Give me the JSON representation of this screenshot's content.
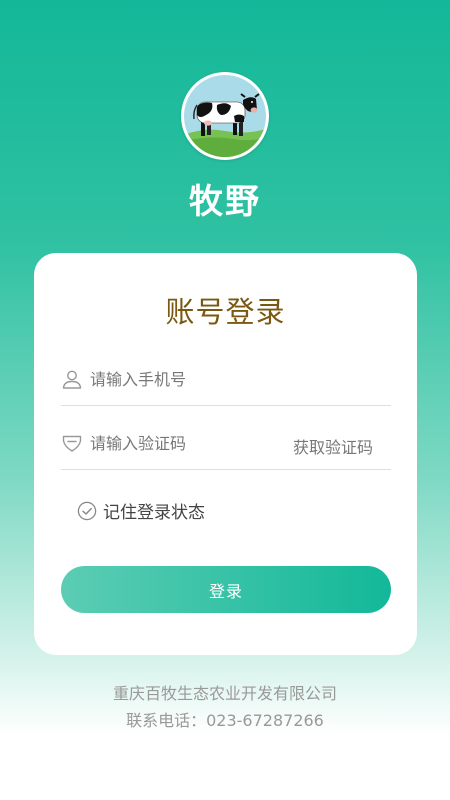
{
  "app": {
    "name": "牧野"
  },
  "login": {
    "title": "账号登录",
    "phone_placeholder": "请输入手机号",
    "code_placeholder": "请输入验证码",
    "get_code_label": "获取验证码",
    "remember_label": "记住登录状态",
    "submit_label": "登录"
  },
  "footer": {
    "company": "重庆百牧生态农业开发有限公司",
    "contact": "联系电话：023-67287266"
  },
  "colors": {
    "brand": "#13b899",
    "title": "#7b5812",
    "placeholder": "#777777",
    "footer_text": "#999999"
  },
  "icons": {
    "phone": "user-icon",
    "code": "shield-icon",
    "remember": "check-circle-icon",
    "logo": "cow-logo"
  }
}
